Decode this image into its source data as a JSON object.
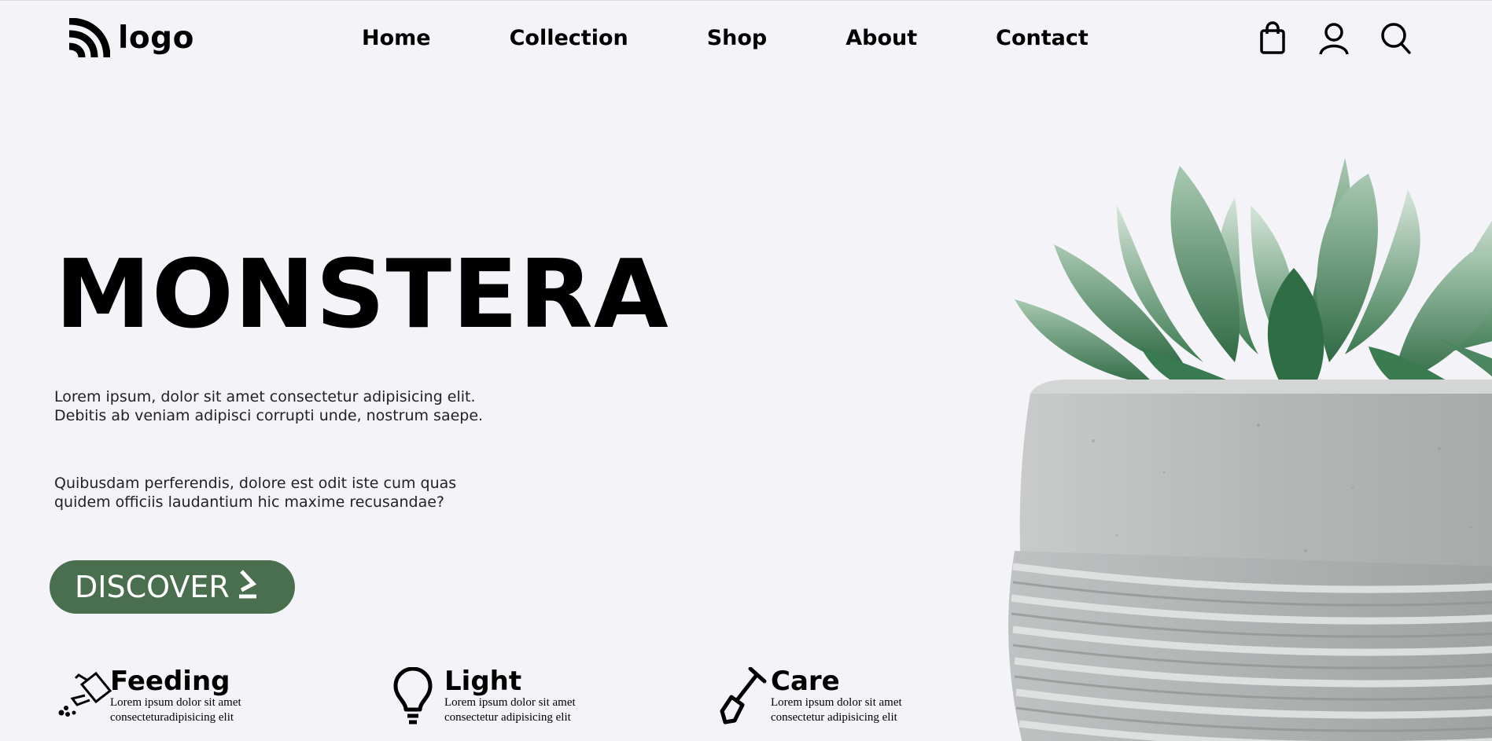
{
  "header": {
    "logo_text": "logo",
    "nav": [
      "Home",
      "Collection",
      "Shop",
      "About",
      "Contact"
    ],
    "icons": [
      "shopping-bag-icon",
      "user-icon",
      "search-icon"
    ]
  },
  "hero": {
    "title": "MONSTERA",
    "paragraph_1": "Lorem ipsum, dolor sit amet consectetur adipisicing elit. Debitis ab veniam adipisci corrupti unde, nostrum saepe.",
    "paragraph_2": "Quibusdam perferendis, dolore est odit iste cum quas quidem officiis laudantium hic maxime recusandae?",
    "button_label": "DISCOVER",
    "button_color": "#4a6f4f"
  },
  "features": [
    {
      "title": "Feeding",
      "desc": "Lorem ipsum dolor sit amet consecteturadipisicing elit",
      "icon": "watering-can-icon"
    },
    {
      "title": "Light",
      "desc": "Lorem ipsum dolor sit amet consectetur adipisicing elit",
      "icon": "light-bulb-icon"
    },
    {
      "title": "Care",
      "desc": "Lorem ipsum dolor sit amet consectetur adipisicing elit",
      "icon": "shovel-icon"
    }
  ]
}
